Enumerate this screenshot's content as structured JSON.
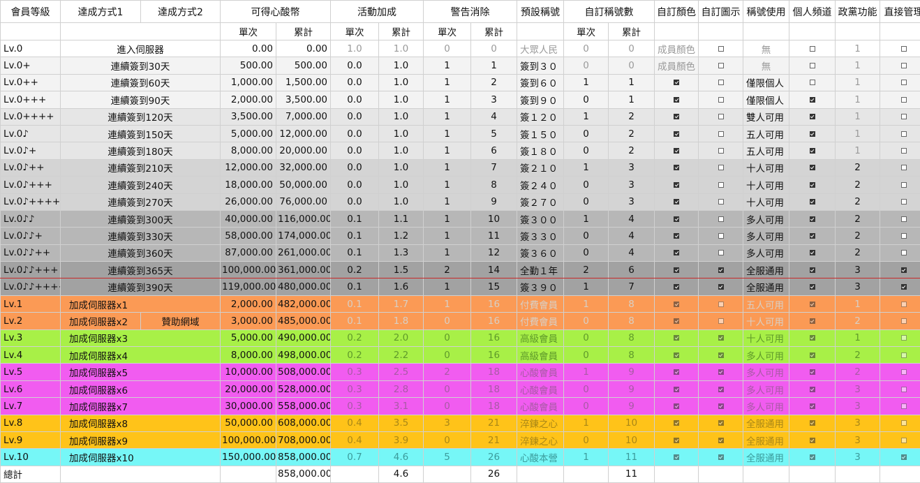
{
  "headers": [
    "會員等級",
    "達成方式1",
    "達成方式2",
    "可得心酸幣",
    "活動加成",
    "警告消除",
    "預設稱號",
    "自訂稱號數",
    "自訂顏色",
    "自訂圖示",
    "稱號使用",
    "個人頻道",
    "政黨功能",
    "直接管理"
  ],
  "subheaders": {
    "single": "單次",
    "cumulative": "累計"
  },
  "rows": [
    {
      "lv": "Lv.0",
      "m1": "進入伺服器",
      "m2": "",
      "coin": "0.00",
      "coinT": "0.00",
      "ev": "1.0",
      "evT": "1.0",
      "w": "0",
      "wT": "0",
      "title": "大眾人民",
      "ct": "0",
      "ctT": "0",
      "color": "成員顏色",
      "icon": "off",
      "use": "無",
      "ch": "off",
      "party": "1",
      "admin": "off"
    },
    {
      "lv": "Lv.0+",
      "m1": "連續簽到30天",
      "m2": "",
      "coin": "500.00",
      "coinT": "500.00",
      "ev": "0.0",
      "evT": "1.0",
      "w": "1",
      "wT": "1",
      "title": "簽到３０",
      "ct": "0",
      "ctT": "0",
      "color": "成員顏色",
      "icon": "off",
      "use": "無",
      "ch": "off",
      "party": "1",
      "admin": "off"
    },
    {
      "lv": "Lv.0++",
      "m1": "連續簽到60天",
      "m2": "",
      "coin": "1,000.00",
      "coinT": "1,500.00",
      "ev": "0.0",
      "evT": "1.0",
      "w": "1",
      "wT": "2",
      "title": "簽到６０",
      "ct": "1",
      "ctT": "1",
      "color": "on",
      "icon": "off",
      "use": "僅限個人",
      "ch": "off",
      "party": "1",
      "admin": "off"
    },
    {
      "lv": "Lv.0+++",
      "m1": "連續簽到90天",
      "m2": "",
      "coin": "2,000.00",
      "coinT": "3,500.00",
      "ev": "0.0",
      "evT": "1.0",
      "w": "1",
      "wT": "3",
      "title": "簽到９０",
      "ct": "0",
      "ctT": "1",
      "color": "on",
      "icon": "off",
      "use": "僅限個人",
      "ch": "on",
      "party": "1",
      "admin": "off"
    },
    {
      "lv": "Lv.0++++",
      "m1": "連續簽到120天",
      "m2": "",
      "coin": "3,500.00",
      "coinT": "7,000.00",
      "ev": "0.0",
      "evT": "1.0",
      "w": "1",
      "wT": "4",
      "title": "簽１２０",
      "ct": "1",
      "ctT": "2",
      "color": "on",
      "icon": "off",
      "use": "雙人可用",
      "ch": "on",
      "party": "1",
      "admin": "off"
    },
    {
      "lv": "Lv.0♪",
      "m1": "連續簽到150天",
      "m2": "",
      "coin": "5,000.00",
      "coinT": "12,000.00",
      "ev": "0.0",
      "evT": "1.0",
      "w": "1",
      "wT": "5",
      "title": "簽１５０",
      "ct": "0",
      "ctT": "2",
      "color": "on",
      "icon": "off",
      "use": "五人可用",
      "ch": "on",
      "party": "1",
      "admin": "off"
    },
    {
      "lv": "Lv.0♪+",
      "m1": "連續簽到180天",
      "m2": "",
      "coin": "8,000.00",
      "coinT": "20,000.00",
      "ev": "0.0",
      "evT": "1.0",
      "w": "1",
      "wT": "6",
      "title": "簽１８０",
      "ct": "0",
      "ctT": "2",
      "color": "on",
      "icon": "off",
      "use": "五人可用",
      "ch": "on",
      "party": "1",
      "admin": "off"
    },
    {
      "lv": "Lv.0♪++",
      "m1": "連續簽到210天",
      "m2": "",
      "coin": "12,000.00",
      "coinT": "32,000.00",
      "ev": "0.0",
      "evT": "1.0",
      "w": "1",
      "wT": "7",
      "title": "簽２１０",
      "ct": "1",
      "ctT": "3",
      "color": "on",
      "icon": "off",
      "use": "十人可用",
      "ch": "on",
      "party": "2",
      "admin": "off"
    },
    {
      "lv": "Lv.0♪+++",
      "m1": "連續簽到240天",
      "m2": "",
      "coin": "18,000.00",
      "coinT": "50,000.00",
      "ev": "0.0",
      "evT": "1.0",
      "w": "1",
      "wT": "8",
      "title": "簽２４０",
      "ct": "0",
      "ctT": "3",
      "color": "on",
      "icon": "off",
      "use": "十人可用",
      "ch": "on",
      "party": "2",
      "admin": "off"
    },
    {
      "lv": "Lv.0♪++++",
      "m1": "連續簽到270天",
      "m2": "",
      "coin": "26,000.00",
      "coinT": "76,000.00",
      "ev": "0.0",
      "evT": "1.0",
      "w": "1",
      "wT": "9",
      "title": "簽２７０",
      "ct": "0",
      "ctT": "3",
      "color": "on",
      "icon": "off",
      "use": "十人可用",
      "ch": "on",
      "party": "2",
      "admin": "off"
    },
    {
      "lv": "Lv.0♪♪",
      "m1": "連續簽到300天",
      "m2": "",
      "coin": "40,000.00",
      "coinT": "116,000.00",
      "ev": "0.1",
      "evT": "1.1",
      "w": "1",
      "wT": "10",
      "title": "簽３００",
      "ct": "1",
      "ctT": "4",
      "color": "on",
      "icon": "off",
      "use": "多人可用",
      "ch": "on",
      "party": "2",
      "admin": "off"
    },
    {
      "lv": "Lv.0♪♪+",
      "m1": "連續簽到330天",
      "m2": "",
      "coin": "58,000.00",
      "coinT": "174,000.00",
      "ev": "0.1",
      "evT": "1.2",
      "w": "1",
      "wT": "11",
      "title": "簽３３０",
      "ct": "0",
      "ctT": "4",
      "color": "on",
      "icon": "off",
      "use": "多人可用",
      "ch": "on",
      "party": "2",
      "admin": "off"
    },
    {
      "lv": "Lv.0♪♪++",
      "m1": "連續簽到360天",
      "m2": "",
      "coin": "87,000.00",
      "coinT": "261,000.00",
      "ev": "0.1",
      "evT": "1.3",
      "w": "1",
      "wT": "12",
      "title": "簽３６０",
      "ct": "0",
      "ctT": "4",
      "color": "on",
      "icon": "off",
      "use": "多人可用",
      "ch": "on",
      "party": "2",
      "admin": "off"
    },
    {
      "lv": "Lv.0♪♪+++",
      "m1": "連續簽到365天",
      "m2": "",
      "coin": "100,000.00",
      "coinT": "361,000.00",
      "ev": "0.2",
      "evT": "1.5",
      "w": "2",
      "wT": "14",
      "title": "全勤１年",
      "ct": "2",
      "ctT": "6",
      "color": "on",
      "icon": "on",
      "use": "全服通用",
      "ch": "on",
      "party": "3",
      "admin": "on"
    },
    {
      "lv": "Lv.0♪♪++++",
      "m1": "連續簽到390天",
      "m2": "",
      "coin": "119,000.00",
      "coinT": "480,000.00",
      "ev": "0.1",
      "evT": "1.6",
      "w": "1",
      "wT": "15",
      "title": "簽３９０",
      "ct": "1",
      "ctT": "7",
      "color": "on",
      "icon": "on",
      "use": "全服通用",
      "ch": "on",
      "party": "3",
      "admin": "on"
    },
    {
      "lv": "Lv.1",
      "m1": "加成伺服器x1",
      "m2": "",
      "coin": "2,000.00",
      "coinT": "482,000.00",
      "ev": "0.1",
      "evT": "1.7",
      "w": "1",
      "wT": "16",
      "title": "付費會員",
      "ct": "1",
      "ctT": "8",
      "color": "on",
      "icon": "off",
      "use": "五人可用",
      "ch": "on",
      "party": "1",
      "admin": "off"
    },
    {
      "lv": "Lv.2",
      "m1": "加成伺服器x2",
      "m2": "贊助網域",
      "coin": "3,000.00",
      "coinT": "485,000.00",
      "ev": "0.1",
      "evT": "1.8",
      "w": "0",
      "wT": "16",
      "title": "付費會員",
      "ct": "0",
      "ctT": "8",
      "color": "on",
      "icon": "off",
      "use": "十人可用",
      "ch": "on",
      "party": "2",
      "admin": "off"
    },
    {
      "lv": "Lv.3",
      "m1": "加成伺服器x3",
      "m2": "",
      "coin": "5,000.00",
      "coinT": "490,000.00",
      "ev": "0.2",
      "evT": "2.0",
      "w": "0",
      "wT": "16",
      "title": "高級會員",
      "ct": "0",
      "ctT": "8",
      "color": "on",
      "icon": "on",
      "use": "十人可用",
      "ch": "on",
      "party": "1",
      "admin": "off"
    },
    {
      "lv": "Lv.4",
      "m1": "加成伺服器x4",
      "m2": "",
      "coin": "8,000.00",
      "coinT": "498,000.00",
      "ev": "0.2",
      "evT": "2.2",
      "w": "0",
      "wT": "16",
      "title": "高級會員",
      "ct": "0",
      "ctT": "8",
      "color": "on",
      "icon": "on",
      "use": "多人可用",
      "ch": "on",
      "party": "2",
      "admin": "off"
    },
    {
      "lv": "Lv.5",
      "m1": "加成伺服器x5",
      "m2": "",
      "coin": "10,000.00",
      "coinT": "508,000.00",
      "ev": "0.3",
      "evT": "2.5",
      "w": "2",
      "wT": "18",
      "title": "心酸會員",
      "ct": "1",
      "ctT": "9",
      "color": "on",
      "icon": "on",
      "use": "多人可用",
      "ch": "on",
      "party": "2",
      "admin": "off"
    },
    {
      "lv": "Lv.6",
      "m1": "加成伺服器x6",
      "m2": "",
      "coin": "20,000.00",
      "coinT": "528,000.00",
      "ev": "0.3",
      "evT": "2.8",
      "w": "0",
      "wT": "18",
      "title": "心酸會員",
      "ct": "0",
      "ctT": "9",
      "color": "on",
      "icon": "on",
      "use": "多人可用",
      "ch": "on",
      "party": "3",
      "admin": "off"
    },
    {
      "lv": "Lv.7",
      "m1": "加成伺服器x7",
      "m2": "",
      "coin": "30,000.00",
      "coinT": "558,000.00",
      "ev": "0.3",
      "evT": "3.1",
      "w": "0",
      "wT": "18",
      "title": "心酸會員",
      "ct": "0",
      "ctT": "9",
      "color": "on",
      "icon": "on",
      "use": "多人可用",
      "ch": "on",
      "party": "3",
      "admin": "off"
    },
    {
      "lv": "Lv.8",
      "m1": "加成伺服器x8",
      "m2": "",
      "coin": "50,000.00",
      "coinT": "608,000.00",
      "ev": "0.4",
      "evT": "3.5",
      "w": "3",
      "wT": "21",
      "title": "淬鍊之心",
      "ct": "1",
      "ctT": "10",
      "color": "on",
      "icon": "on",
      "use": "全服通用",
      "ch": "on",
      "party": "3",
      "admin": "off"
    },
    {
      "lv": "Lv.9",
      "m1": "加成伺服器x9",
      "m2": "",
      "coin": "100,000.00",
      "coinT": "708,000.00",
      "ev": "0.4",
      "evT": "3.9",
      "w": "0",
      "wT": "21",
      "title": "淬鍊之心",
      "ct": "0",
      "ctT": "10",
      "color": "on",
      "icon": "on",
      "use": "全服通用",
      "ch": "on",
      "party": "3",
      "admin": "off"
    },
    {
      "lv": "Lv.10",
      "m1": "加成伺服器x10",
      "m2": "",
      "coin": "150,000.00",
      "coinT": "858,000.00",
      "ev": "0.7",
      "evT": "4.6",
      "w": "5",
      "wT": "26",
      "title": "心酸本營",
      "ct": "1",
      "ctT": "11",
      "color": "on",
      "icon": "on",
      "use": "全服通用",
      "ch": "on",
      "party": "3",
      "admin": "on"
    }
  ],
  "row_styles": [
    "bg0",
    "bg1",
    "bg1",
    "bg1",
    "bg2",
    "bg2",
    "bg2",
    "bg3",
    "bg3",
    "bg3",
    "bg4",
    "bg4",
    "bg4",
    "bg5",
    "bg5",
    "c-or",
    "c-or",
    "c-gr",
    "c-gr",
    "c-mg",
    "c-mg",
    "c-mg",
    "c-yl",
    "c-yl",
    "c-cy"
  ],
  "totals": {
    "label": "總計",
    "coinT": "858,000.00",
    "evT": "4.6",
    "wT": "26",
    "ctT": "11"
  }
}
